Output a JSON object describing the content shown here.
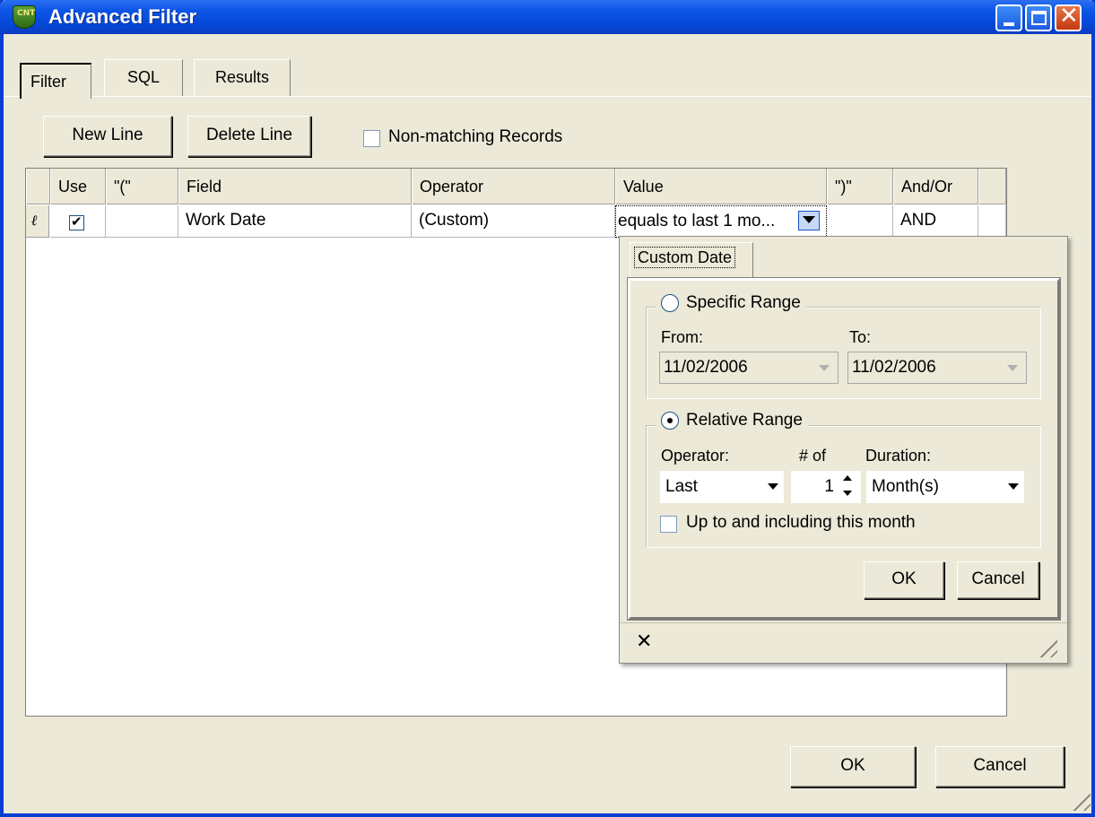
{
  "window": {
    "title": "Advanced Filter",
    "icon": "app-shield-icon"
  },
  "tabs": [
    {
      "label": "Filter",
      "selected": true
    },
    {
      "label": "SQL",
      "selected": false
    },
    {
      "label": "Results",
      "selected": false
    }
  ],
  "toolbar": {
    "new_line": "New Line",
    "delete_line": "Delete Line",
    "non_matching": {
      "label": "Non-matching Records",
      "checked": false
    }
  },
  "grid": {
    "columns": [
      "Use",
      "\"(\"",
      "Field",
      "Operator",
      "Value",
      "\")\"",
      "And/Or"
    ],
    "rows": [
      {
        "use": true,
        "open_paren": "",
        "field": "Work Date",
        "operator": "(Custom)",
        "value": "equals to last 1 mo...",
        "close_paren": "",
        "and_or": "AND"
      }
    ]
  },
  "custom_date": {
    "tab_label": "Custom Date",
    "specific_range": {
      "label": "Specific Range",
      "selected": false,
      "from_label": "From:",
      "to_label": "To:",
      "from": "11/02/2006",
      "to": "11/02/2006"
    },
    "relative_range": {
      "label": "Relative Range",
      "selected": true,
      "operator_label": "Operator:",
      "count_label": "# of",
      "duration_label": "Duration:",
      "operator": "Last",
      "count": "1",
      "duration": "Month(s)",
      "include_label": "Up to and including this month",
      "include_checked": false
    },
    "ok": "OK",
    "cancel": "Cancel"
  },
  "footer": {
    "ok": "OK",
    "cancel": "Cancel"
  }
}
